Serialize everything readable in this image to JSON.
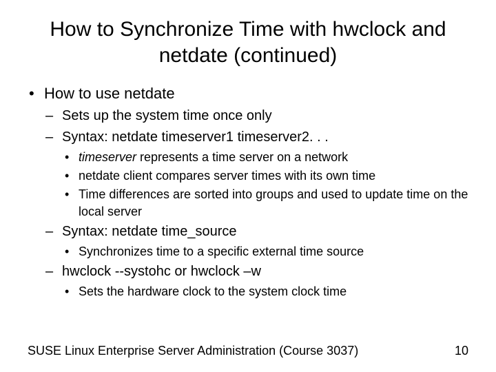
{
  "title": "How to Synchronize Time with hwclock and netdate (continued)",
  "b1": "How to use netdate",
  "b1_1": "Sets up the system time once only",
  "b1_2": "Syntax: netdate timeserver1 timeserver2. . .",
  "b1_2_1_pre": "timeserver",
  "b1_2_1_post": " represents a time server on a network",
  "b1_2_2": "netdate client compares server times with its own time",
  "b1_2_3": "Time differences are sorted into groups and used to update time on the local server",
  "b1_3": "Syntax: netdate time_source",
  "b1_3_1": "Synchronizes time to a specific external time source",
  "b1_4": "hwclock --systohc or hwclock –w",
  "b1_4_1": "Sets the hardware clock to the system clock time",
  "footer": "SUSE Linux Enterprise Server Administration (Course 3037)",
  "page": "10"
}
